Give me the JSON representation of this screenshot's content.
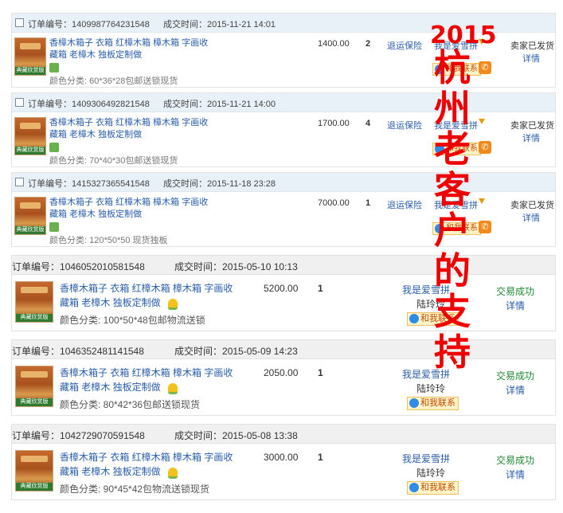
{
  "labels": {
    "order_no": "订单编号：",
    "deal_time": "成交时间：",
    "refund_insurance": "退运保险",
    "seller_shipped": "卖家已发货",
    "detail": "详情",
    "trade_success": "交易成功",
    "contact_me": "和我联系",
    "brand_tag": "典藏欣赏版"
  },
  "product": {
    "title_line1": "香樟木箱子 衣箱 红樟木箱 樟木箱 字画收",
    "title_line2": "藏箱 老樟木 独板定制做"
  },
  "orders_new": [
    {
      "order_no": "1409987764231548",
      "time": "2015-11-21 14:01",
      "spec": "颜色分类: 60*36*28包邮送锁现货",
      "price": "1400.00",
      "qty": "2",
      "buyer": "我是爱雪拼"
    },
    {
      "order_no": "1409306492821548",
      "time": "2015-11-21 14:00",
      "spec": "颜色分类: 70*40*30包邮送锁现货",
      "price": "1700.00",
      "qty": "4",
      "buyer": "我是爱雪拼"
    },
    {
      "order_no": "1415327365541548",
      "time": "2015-11-18 23:28",
      "spec": "颜色分类: 120*50*50 现货独板",
      "price": "7000.00",
      "qty": "1",
      "buyer": "我是爱雪拼"
    }
  ],
  "orders_old": [
    {
      "order_no": "1046052010581548",
      "time": "2015-05-10 10:13",
      "spec": "颜色分类: 100*50*48包邮物流送锁",
      "price": "5200.00",
      "qty": "1",
      "buyer": "我是爱雪拼",
      "buyer_name": "陆玲玲"
    },
    {
      "order_no": "1046352481141548",
      "time": "2015-05-09 14:23",
      "spec": "颜色分类: 80*42*36包邮送锁现货",
      "price": "2050.00",
      "qty": "1",
      "buyer": "我是爱雪拼",
      "buyer_name": "陆玲玲"
    },
    {
      "order_no": "1042729070591548",
      "time": "2015-05-08 13:38",
      "spec": "颜色分类: 90*45*42包物流送锁现货",
      "price": "3000.00",
      "qty": "1",
      "buyer": "我是爱雪拼",
      "buyer_name": "陆玲玲"
    }
  ],
  "overlay": {
    "year": "2015",
    "chars": [
      "杭",
      "州",
      "老",
      "客",
      "户",
      "的",
      "支",
      "持"
    ]
  },
  "colors": {
    "overlay_text": "#ee0000",
    "link": "#2a5ea8",
    "success": "#1f8a34",
    "header_bg": "#e8f0f8"
  }
}
